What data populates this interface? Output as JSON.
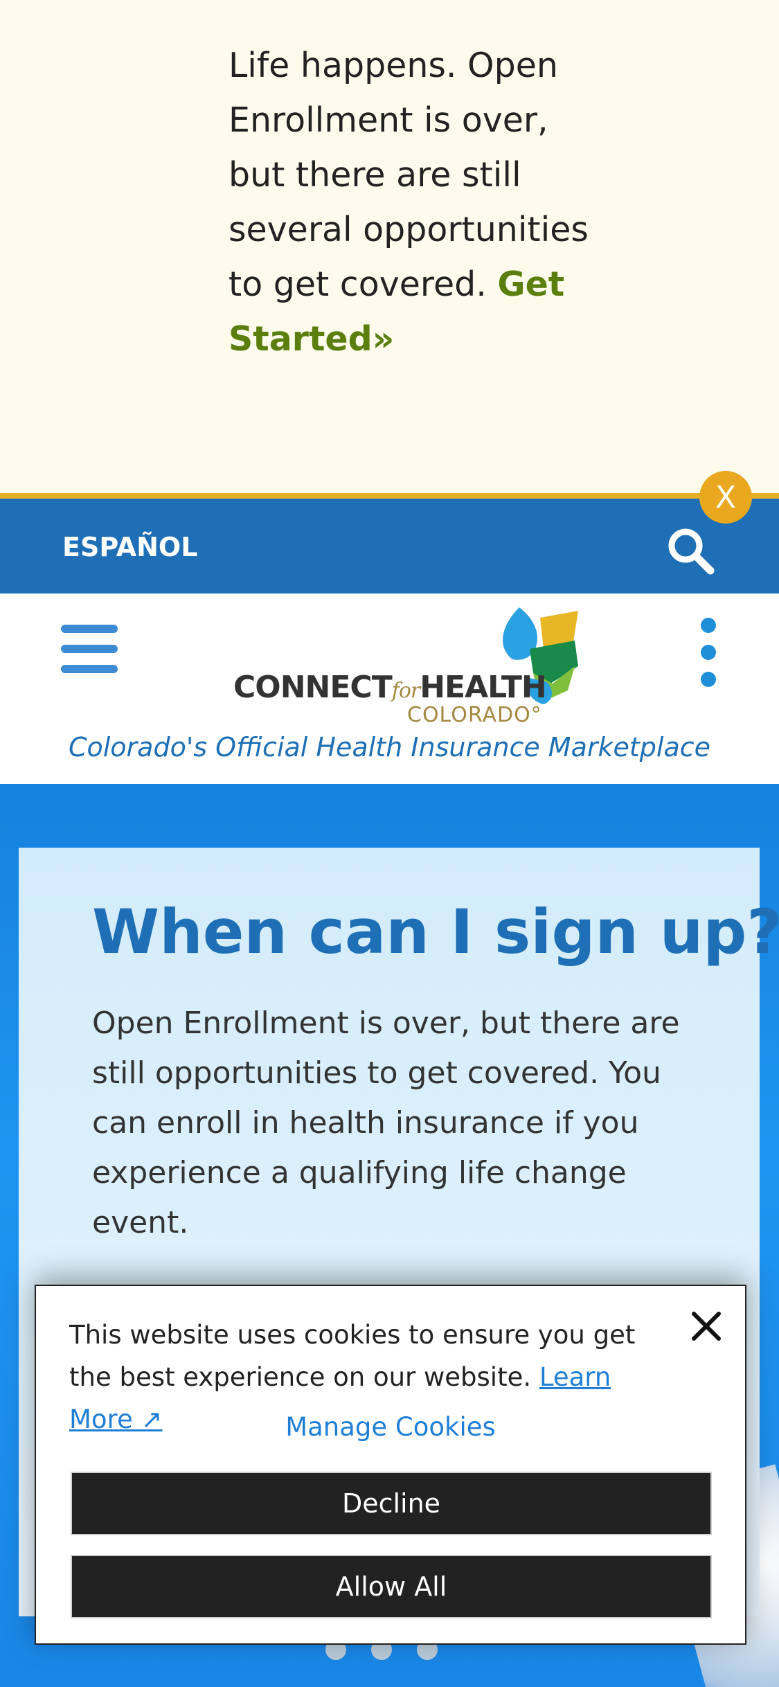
{
  "banner": {
    "text": "Life happens. Open Enrollment is over, but there are still several opportunities to get covered.",
    "link_label": "Get Started»",
    "close_label": "X"
  },
  "topbar": {
    "language_label": "ESPAÑOL",
    "search_icon": "search-icon"
  },
  "header": {
    "menu_icon": "hamburger-menu-icon",
    "more_icon": "vertical-dots-icon",
    "logo": {
      "connect": "CONNECT",
      "for": "for",
      "health": "HEALTH",
      "state": "COLORADO°"
    },
    "tagline": "Colorado's Official Health Insurance Marketplace"
  },
  "hero": {
    "title": "When can I sign up?",
    "body": "Open Enrollment is over, but there are still opportunities to get covered. You can enroll in health insurance if you experience a qualifying life change event."
  },
  "cookie": {
    "text": "This website uses cookies to ensure you get the best experience on our website.",
    "learn_more": "Learn More ↗",
    "manage": "Manage Cookies",
    "decline": "Decline",
    "allow_all": "Allow All",
    "close_icon": "close-icon"
  },
  "colors": {
    "banner_bg": "#fdfbec",
    "brand_blue": "#1e6fb5",
    "accent_gold": "#e7b025",
    "link_green": "#5a7f0f",
    "link_blue": "#1f7fd6"
  }
}
